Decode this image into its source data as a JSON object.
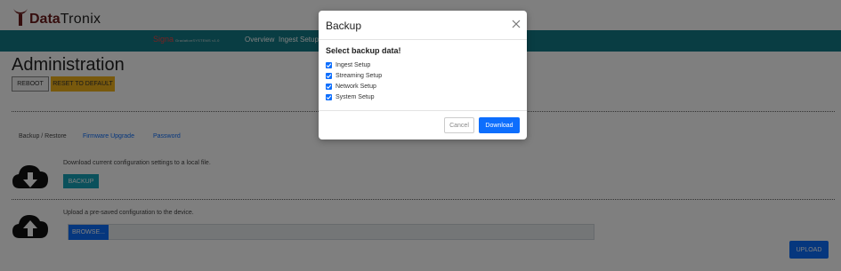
{
  "logo": {
    "part1": "Data",
    "part2": "Tronix"
  },
  "navbar": {
    "brand": "Signa",
    "version": "GradationSYSTEMS v1.0",
    "links": [
      "Overview",
      "Ingest Setup"
    ]
  },
  "admin": {
    "title": "Administration",
    "reboot_label": "REBOOT",
    "reset_label": "RESET TO DEFAULT"
  },
  "tabs": [
    "Backup / Restore",
    "Firmware Upgrade",
    "Password"
  ],
  "backup_section": {
    "text": "Download current configuration settings to a local file.",
    "button": "BACKUP"
  },
  "upload_section": {
    "text": "Upload a pre-saved configuration to the device.",
    "browse": "BROWSE...",
    "upload": "UPLOAD"
  },
  "modal": {
    "title": "Backup",
    "heading": "Select backup data!",
    "options": [
      {
        "label": "Ingest Setup",
        "checked": true
      },
      {
        "label": "Streaming Setup",
        "checked": true
      },
      {
        "label": "Network Setup",
        "checked": true
      },
      {
        "label": "System Setup",
        "checked": true
      }
    ],
    "cancel_label": "Cancel",
    "download_label": "Download"
  },
  "colors": {
    "navbar": "#137a86",
    "reset": "#f0b31a",
    "backup": "#17a2b8",
    "primary": "#0d6efd"
  }
}
